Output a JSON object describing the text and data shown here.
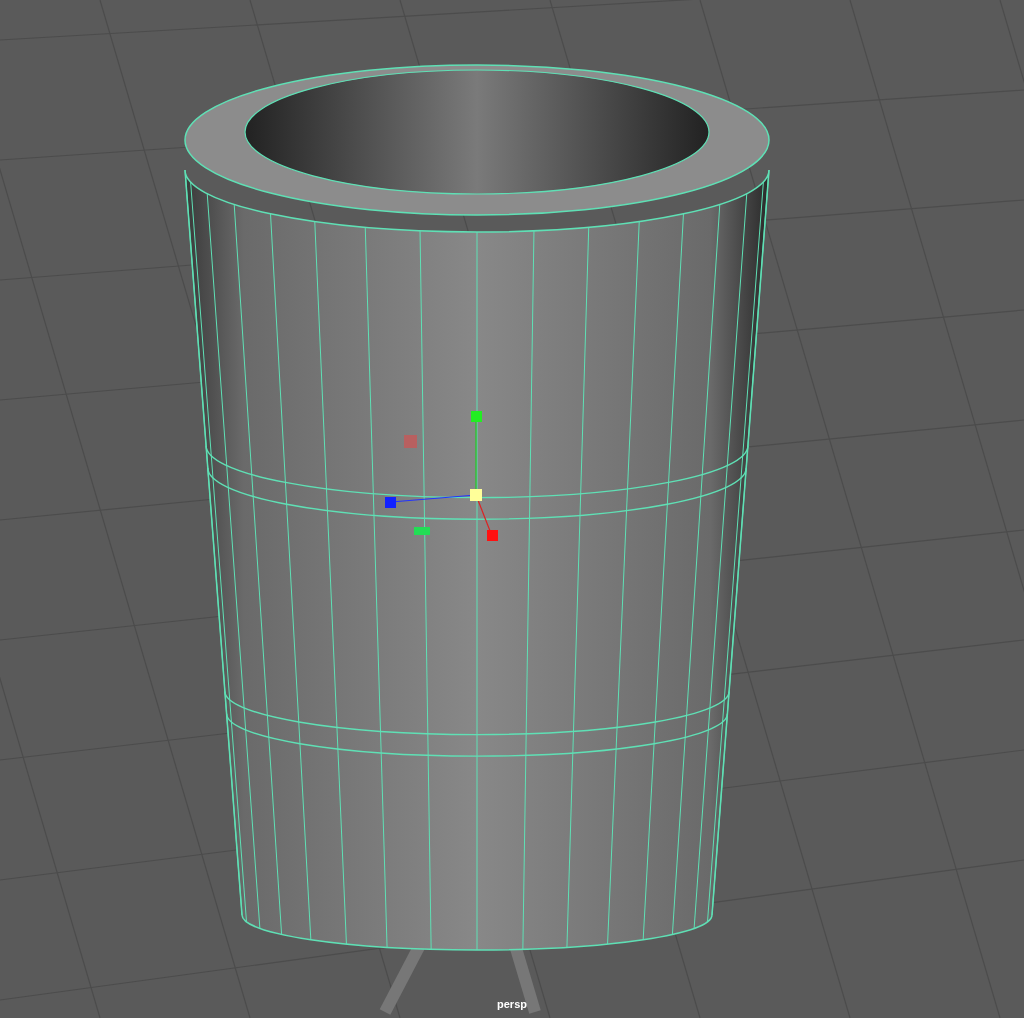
{
  "viewport": {
    "camera_label": "persp"
  }
}
